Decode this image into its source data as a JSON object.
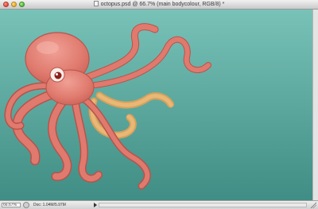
{
  "window": {
    "title": "octopus.psd @ 66.7% (main bodycolour, RGB/8) *"
  },
  "statusbar": {
    "zoom": "66.67%",
    "doc_info": "Doc: 1.04M/5.97M"
  },
  "colors": {
    "canvas_top": "#78c2b8",
    "canvas_bottom": "#3f8d84",
    "octopus_body": "#e07a6e",
    "octopus_outline": "#b8534b",
    "sucker_color": "#d9a15a"
  }
}
